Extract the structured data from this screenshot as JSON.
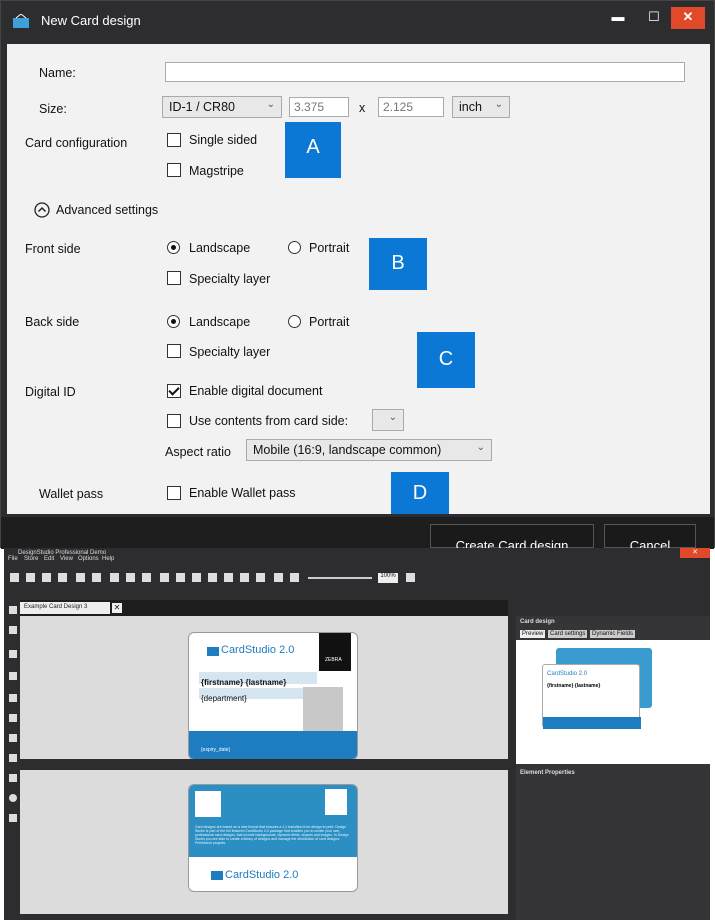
{
  "dialog": {
    "title": "New Card design",
    "labels": {
      "name": "Name:",
      "size": "Size:",
      "card_config": "Card configuration",
      "front": "Front side",
      "back": "Back side",
      "digital_id": "Digital ID",
      "wallet": "Wallet pass",
      "aspect": "Aspect ratio"
    },
    "size_select": "ID-1 / CR80",
    "width": "3.375",
    "x": "x",
    "height": "2.125",
    "unit": "inch",
    "single_sided": "Single sided",
    "magstripe": "Magstripe",
    "advanced": "Advanced settings",
    "landscape": "Landscape",
    "portrait": "Portrait",
    "specialty": "Specialty layer",
    "enable_digital": "Enable digital document",
    "use_contents": "Use contents from card side:",
    "aspect_value": "Mobile (16:9, landscape common)",
    "enable_wallet": "Enable Wallet pass",
    "create": "Create Card design",
    "cancel": "Cancel",
    "badges": [
      "A",
      "B",
      "C",
      "D"
    ]
  },
  "app": {
    "title": "DesignStudio Professional Demo",
    "menu": [
      "File",
      "Store",
      "Edit",
      "View",
      "Options",
      "Help"
    ],
    "zoom": "100%",
    "tab": "Example Card Design 3",
    "card": {
      "brand": "CardStudio 2.0",
      "name": "{firstname} {lastname}",
      "dept": "{department}",
      "expiry": "{expiry_date}",
      "back_text": "Card designs are based on a new format that ensures a 1:1 transition from design to print. Design Studio is part of the full featured CardStudio 2.0 package that enables you to create your own, professional card designs, that include backgrounds, dynamic fields, shapes and images. In Design Studio you are able to create a library of designs and manage the distribution of card designs. PrintMarch projects.",
      "zebra": "ZEBRA"
    },
    "right": {
      "title": "Card design",
      "tabs": [
        "Preview",
        "Card settings",
        "Dynamic Fields"
      ],
      "props": "Element Properties"
    }
  }
}
